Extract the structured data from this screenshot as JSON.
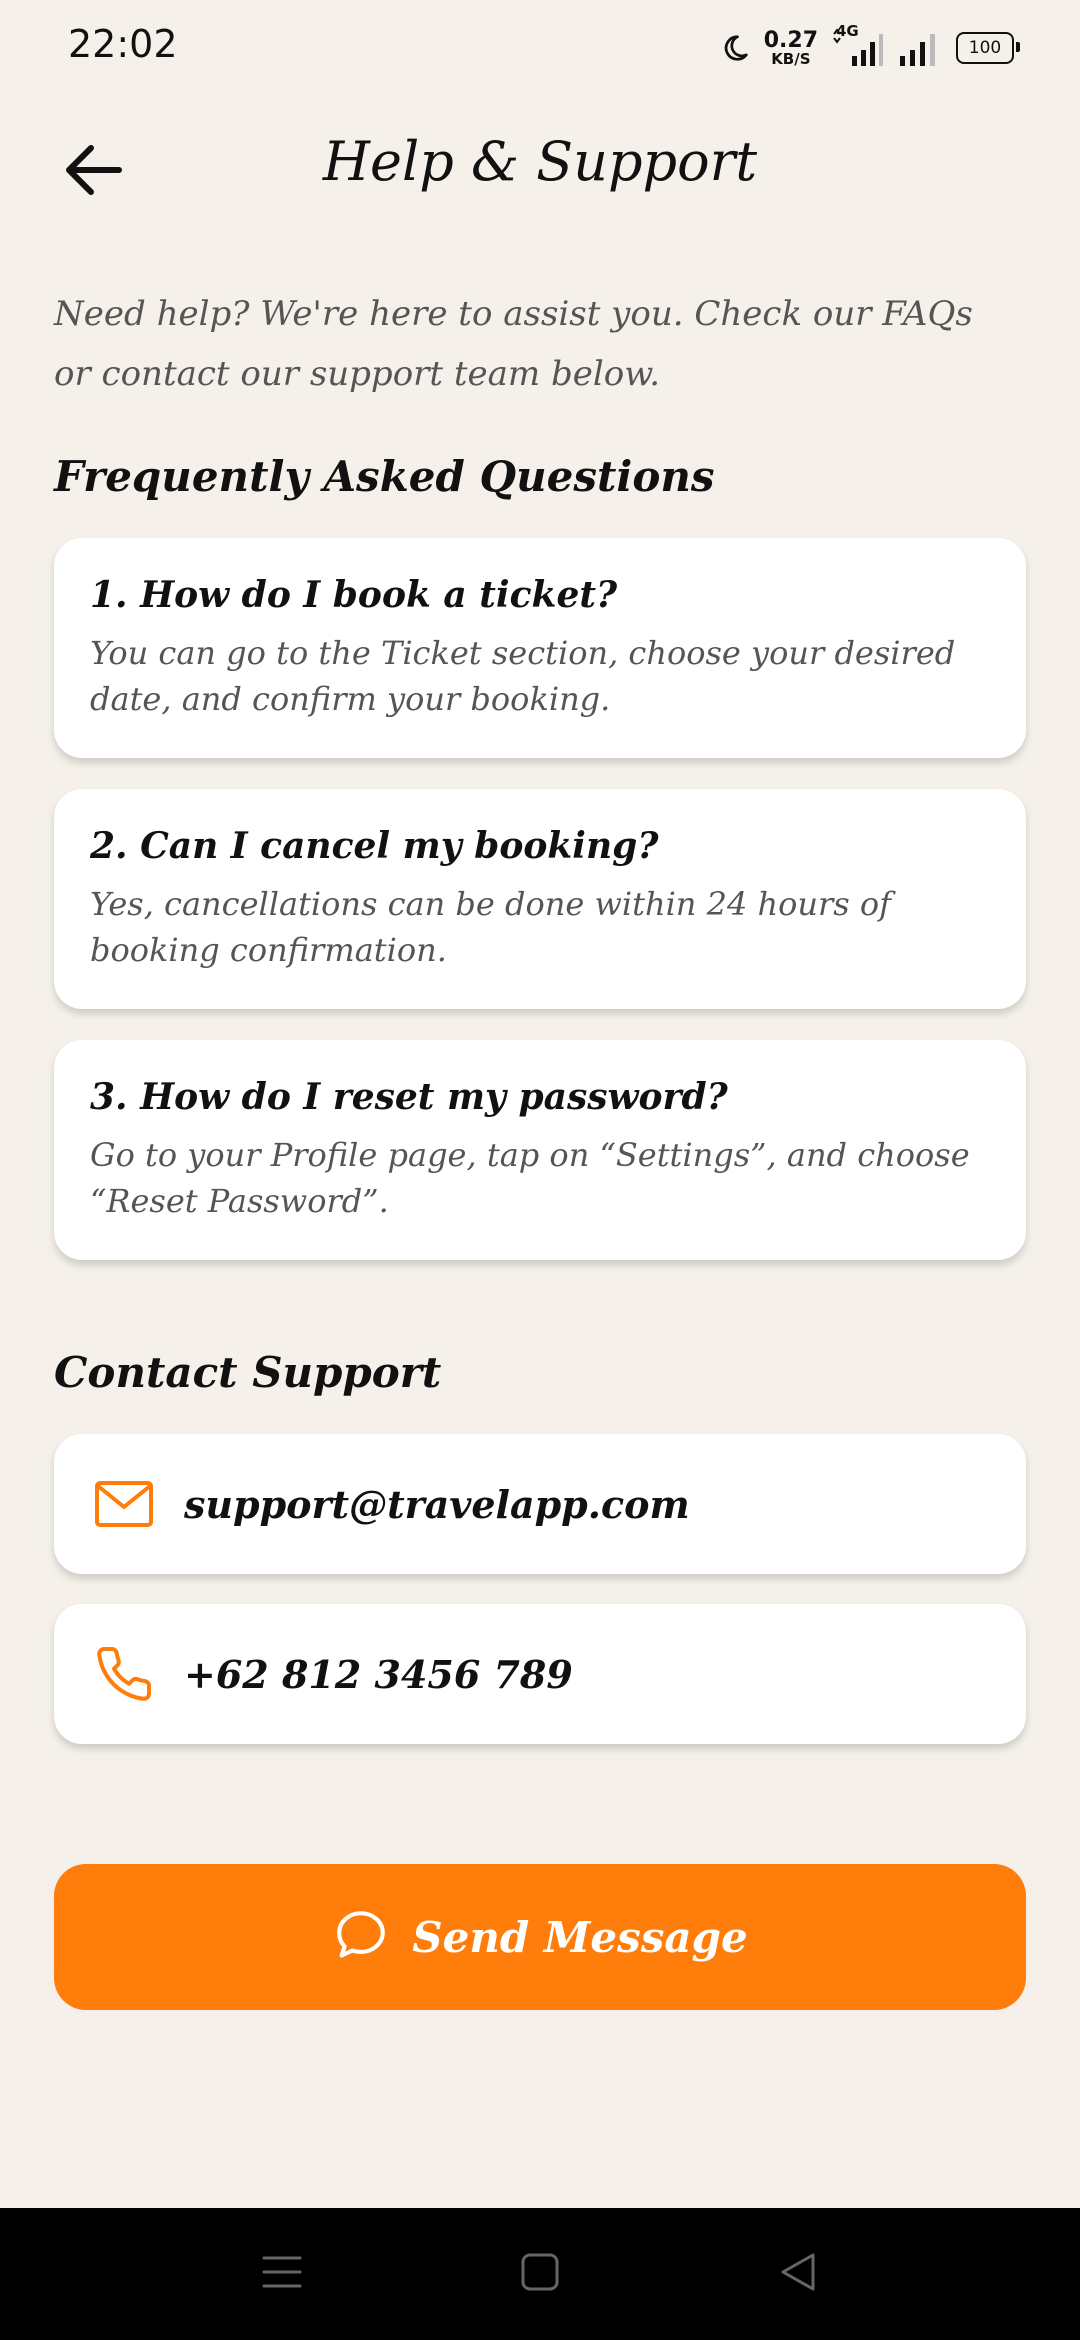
{
  "status_bar": {
    "time": "22:02",
    "net_speed_value": "0.27",
    "net_speed_unit": "KB/S",
    "network_type": "4G",
    "battery": "100"
  },
  "header": {
    "title": "Help & Support"
  },
  "intro_text": "Need help? We're here to assist you. Check our FAQs or contact our support team below.",
  "faq": {
    "section_title": "Frequently Asked Questions",
    "items": [
      {
        "question": "1. How do I book a ticket?",
        "answer": "You can go to the Ticket section, choose your desired date, and confirm your booking."
      },
      {
        "question": "2. Can I cancel my booking?",
        "answer": "Yes, cancellations can be done within 24 hours of booking confirmation."
      },
      {
        "question": "3. How do I reset my password?",
        "answer": "Go to your Profile page, tap on “Settings”, and choose “Reset Password”."
      }
    ]
  },
  "contact": {
    "section_title": "Contact Support",
    "email": "support@travelapp.com",
    "phone": "+62 812 3456 789"
  },
  "send_button": {
    "label": "Send Message"
  },
  "colors": {
    "accent": "#FF7D0A",
    "background": "#F5F1EA",
    "card": "#FFFFFF"
  },
  "icons": {
    "back": "arrow-left-icon",
    "email": "mail-icon",
    "phone": "phone-icon",
    "send": "chat-bubble-icon"
  }
}
